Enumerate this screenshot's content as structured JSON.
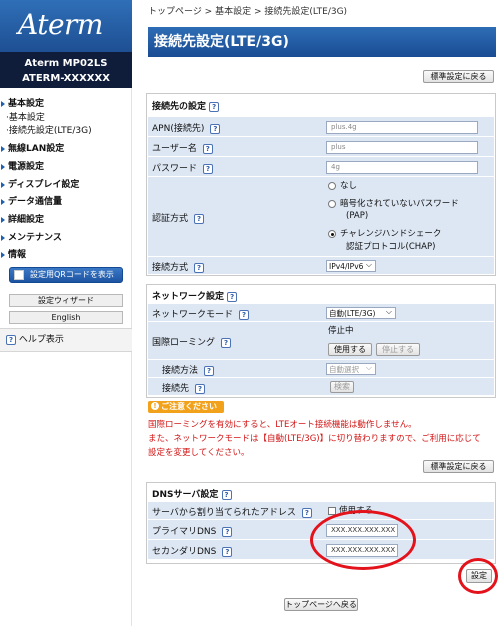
{
  "sidebar": {
    "logo": "Aterm",
    "model_line1": "Aterm   MP02LS",
    "model_line2": "ATERM-XXXXXX",
    "menu": [
      {
        "label": "基本設定"
      },
      {
        "label": "基本設定"
      },
      {
        "label": "接続先設定(LTE/3G)"
      },
      {
        "label": "無線LAN設定"
      },
      {
        "label": "電源設定"
      },
      {
        "label": "ディスプレイ設定"
      },
      {
        "label": "データ通信量"
      },
      {
        "label": "詳細設定"
      },
      {
        "label": "メンテナンス"
      },
      {
        "label": "情報"
      }
    ],
    "qr_button": "設定用QRコードを表示",
    "wizard_button": "設定ウィザード",
    "english_button": "English",
    "help": "ヘルプ表示"
  },
  "breadcrumb": "トップページ > 基本設定 > 接続先設定(LTE/3G)",
  "page_title": "接続先設定(LTE/3G)",
  "restore_default_button": "標準設定に戻る",
  "connection": {
    "heading": "接続先の設定",
    "apn_label": "APN(接続先)",
    "apn_value": "plus.4g",
    "user_label": "ユーザー名",
    "user_value": "plus",
    "password_label": "パスワード",
    "password_value": "4g",
    "auth_label": "認証方式",
    "auth_options": [
      "なし",
      "暗号化されていないパスワード",
      "(PAP)",
      "チャレンジハンドシェーク",
      "認証プロトコル(CHAP)"
    ],
    "conn_type_label": "接続方式",
    "conn_type_value": "IPv4/IPv6"
  },
  "network": {
    "heading": "ネットワーク設定",
    "mode_label": "ネットワークモード",
    "mode_value": "自動(LTE/3G)",
    "roaming_label": "国際ローミング",
    "roaming_status": "停止中",
    "roaming_use_button": "使用する",
    "roaming_stop_button": "停止する",
    "method_label": "接続方法",
    "method_value": "自動選択",
    "dest_label": "接続先",
    "dest_button": "検索"
  },
  "notice": {
    "badge": "ご注意ください",
    "line1": "国際ローミングを有効にすると、LTEオート接続機能は動作しません。",
    "line2": "また、ネットワークモードは【自動(LTE/3G)】に切り替わりますので、ご利用に応じて",
    "line3": "設定を変更してください。"
  },
  "dns": {
    "heading": "DNSサーバ設定",
    "server_assigned_label": "サーバから割り当てられたアドレス",
    "use_label": "使用する",
    "primary_label": "プライマリDNS",
    "primary_value": "XXX.XXX.XXX.XXX",
    "secondary_label": "セカンダリDNS",
    "secondary_value": "XXX.XXX.XXX.XXX"
  },
  "apply_button": "設定",
  "back_to_top_button": "トップページへ戻る",
  "help_icon": "?",
  "colors": {
    "accent": "#1e4f93",
    "row_bg": "#dde7f4",
    "warning": "#d21414",
    "highlight": "#e3121b"
  }
}
